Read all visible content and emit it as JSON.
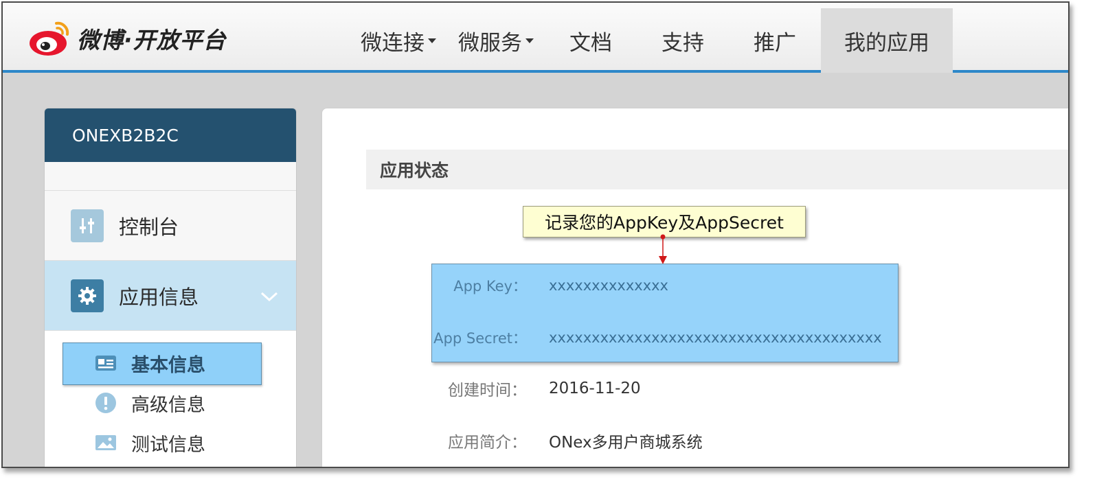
{
  "header": {
    "brand": "微博·开放平台",
    "nav": [
      {
        "label": "微连接",
        "dropdown": true
      },
      {
        "label": "微服务",
        "dropdown": true
      },
      {
        "label": "文档",
        "dropdown": false
      },
      {
        "label": "支持",
        "dropdown": false
      },
      {
        "label": "推广",
        "dropdown": false
      },
      {
        "label": "我的应用",
        "dropdown": false,
        "active": true
      }
    ]
  },
  "sidebar": {
    "app_name": "ONEXB2B2C",
    "items": [
      {
        "label": "控制台",
        "icon": "sliders-icon"
      },
      {
        "label": "应用信息",
        "icon": "gear-icon",
        "active": true
      }
    ],
    "sub_items": [
      {
        "label": "基本信息",
        "icon": "id-card-icon",
        "selected": true
      },
      {
        "label": "高级信息",
        "icon": "exclamation-icon"
      },
      {
        "label": "测试信息",
        "icon": "image-card-icon"
      }
    ]
  },
  "main": {
    "section_title": "应用状态",
    "callout": "记录您的AppKey及AppSecret",
    "fields": [
      {
        "label": "App Key：",
        "value": "xxxxxxxxxxxxxx"
      },
      {
        "label": "App Secret：",
        "value": "xxxxxxxxxxxxxxxxxxxxxxxxxxxxxxxxxxxxxxx"
      },
      {
        "label": "创建时间：",
        "value": "2016-11-20"
      },
      {
        "label": "应用简介：",
        "value": "ONex多用户商城系统"
      }
    ]
  },
  "colors": {
    "header_accent": "#2d87c9",
    "sidebar_head": "#24516f",
    "highlight": "#96d3fa",
    "callout_bg": "#fefed2"
  }
}
